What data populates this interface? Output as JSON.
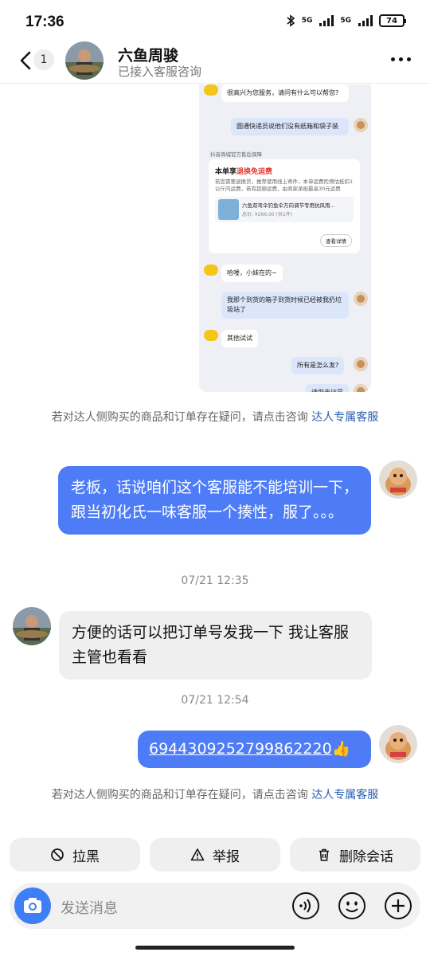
{
  "status_bar": {
    "time": "17:36",
    "network_1": "5G",
    "network_2": "5G",
    "battery": "74"
  },
  "header": {
    "unread_count": "1",
    "contact_name": "六鱼周骏",
    "subtitle": "已接入客服咨询"
  },
  "screenshot": {
    "greeting": "很高兴为您服务，请问有什么可以帮您?",
    "user_msg_1": "圆通快递员说他们没有纸箱和袋子装",
    "guarantee_note": "抖音商城官方售后保障",
    "card_title_prefix": "本单享",
    "card_title_highlight": "退换免运费",
    "card_body": "若您需要退换货，推荐使用线上寄件，本单运费险预估抵扣1公斤内运费，若有超额运费，由商家承担最高30元运费",
    "product_title": "六鱼双弯伞钓鱼伞万向调节专用抗风雨...",
    "product_price": "总价: ¥266.00 (共1件)",
    "card_button": "查看详情",
    "bot_msg_2": "哈喽，小妹在的~",
    "user_msg_2": "我那个到货的箱子到货时候已经被我扔垃圾站了",
    "bot_msg_3": "其他试试",
    "user_msg_3": "所有是怎么发?",
    "user_msg_4": "请您去证是"
  },
  "notice": {
    "text": "若对达人侧购买的商品和订单存在疑问，请点击咨询",
    "link": "达人专属客服"
  },
  "messages": [
    {
      "text": "老板，话说咱们这个客服能不能培训一下，跟当初化氏一味客服一个揍性，服了。。。"
    },
    {
      "timestamp": "07/21 12:35",
      "text": "方便的话可以把订单号发我一下 我让客服主管也看看"
    },
    {
      "timestamp": "07/21 12:54",
      "text": "6944309252799862220",
      "emoji": "👍"
    }
  ],
  "actions": {
    "block": "拉黑",
    "report": "举报",
    "delete": "删除会话"
  },
  "input": {
    "placeholder": "发送消息"
  },
  "colors": {
    "outgoing_bubble": "#4e7cf6",
    "incoming_bubble": "#efefef",
    "link": "#2a5db0",
    "camera_button": "#3e7ef7"
  },
  "icons": [
    "back-icon",
    "more-icon",
    "block-icon",
    "report-icon",
    "delete-icon",
    "camera-icon",
    "voice-icon",
    "emoji-icon",
    "plus-icon"
  ]
}
